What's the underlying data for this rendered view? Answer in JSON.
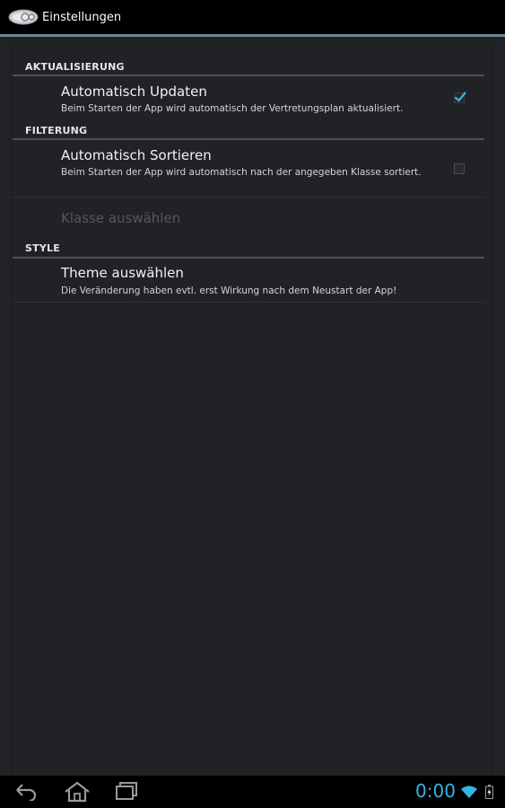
{
  "action_bar": {
    "title": "Einstellungen",
    "icon": "app-logo-icon"
  },
  "categories": [
    {
      "title": "AKTUALISIERUNG",
      "items": [
        {
          "title": "Automatisch Updaten",
          "summary": "Beim Starten der App wird automatisch der Vertretungsplan aktualisiert.",
          "checkbox": true,
          "checked": true
        }
      ]
    },
    {
      "title": "FILTERUNG",
      "items": [
        {
          "title": "Automatisch Sortieren",
          "summary": "Beim Starten der App wird automatisch nach der angegeben Klasse sortiert.",
          "checkbox": true,
          "checked": false
        },
        {
          "title": "Klasse auswählen",
          "enabled": false
        }
      ]
    },
    {
      "title": "STYLE",
      "items": [
        {
          "title": "Theme auswählen",
          "summary": "Die Veränderung haben evtl. erst Wirkung nach dem Neustart der App!"
        }
      ]
    }
  ],
  "nav_bar": {
    "back": "back-arrow-icon",
    "home": "home-icon",
    "recents": "recent-apps-icon",
    "clock": "0:00",
    "wifi": "wifi-icon",
    "battery": "battery-icon"
  },
  "colors": {
    "accent": "#33b5e5",
    "background": "#222327",
    "action_bar": "#000000"
  }
}
